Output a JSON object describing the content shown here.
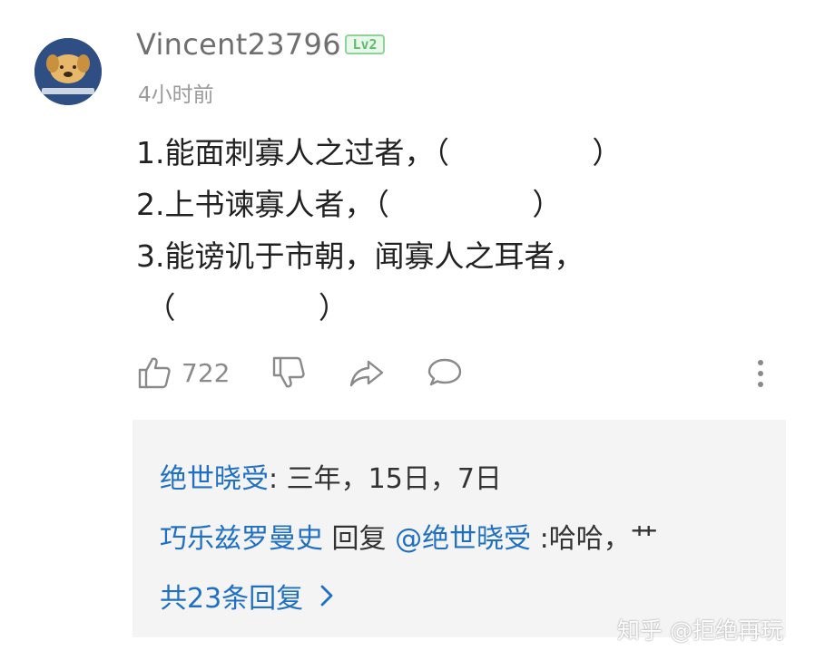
{
  "comment": {
    "username": "Vincent23796",
    "level_badge": "Lv2",
    "timestamp": "4小时前",
    "lines": [
      "1.能面刺寡人之过者，（               ）",
      "2.上书谏寡人者，（               ）",
      "3.能谤讥于市朝，闻寡人之耳者，",
      " （               ）"
    ],
    "actions": {
      "like_count": "722",
      "like_icon": "thumbs-up-icon",
      "dislike_icon": "thumbs-down-icon",
      "share_icon": "share-icon",
      "comment_icon": "comment-bubble-icon",
      "more_icon": "more-vertical-icon"
    }
  },
  "replies": {
    "items": [
      {
        "author": "绝世晓受",
        "separator": ":",
        "text": " 三年，15日，7日"
      },
      {
        "author": "巧乐兹罗曼史",
        "reply_word": " 回复 ",
        "reply_to": "@绝世晓受",
        "text": " :哈哈，艹"
      }
    ],
    "more_label": "共23条回复"
  },
  "watermark": "知乎 @拒绝再玩",
  "colors": {
    "link": "#1f6fc2",
    "badge": "#5cbd6d",
    "reply_background": "#f4f4f4"
  }
}
